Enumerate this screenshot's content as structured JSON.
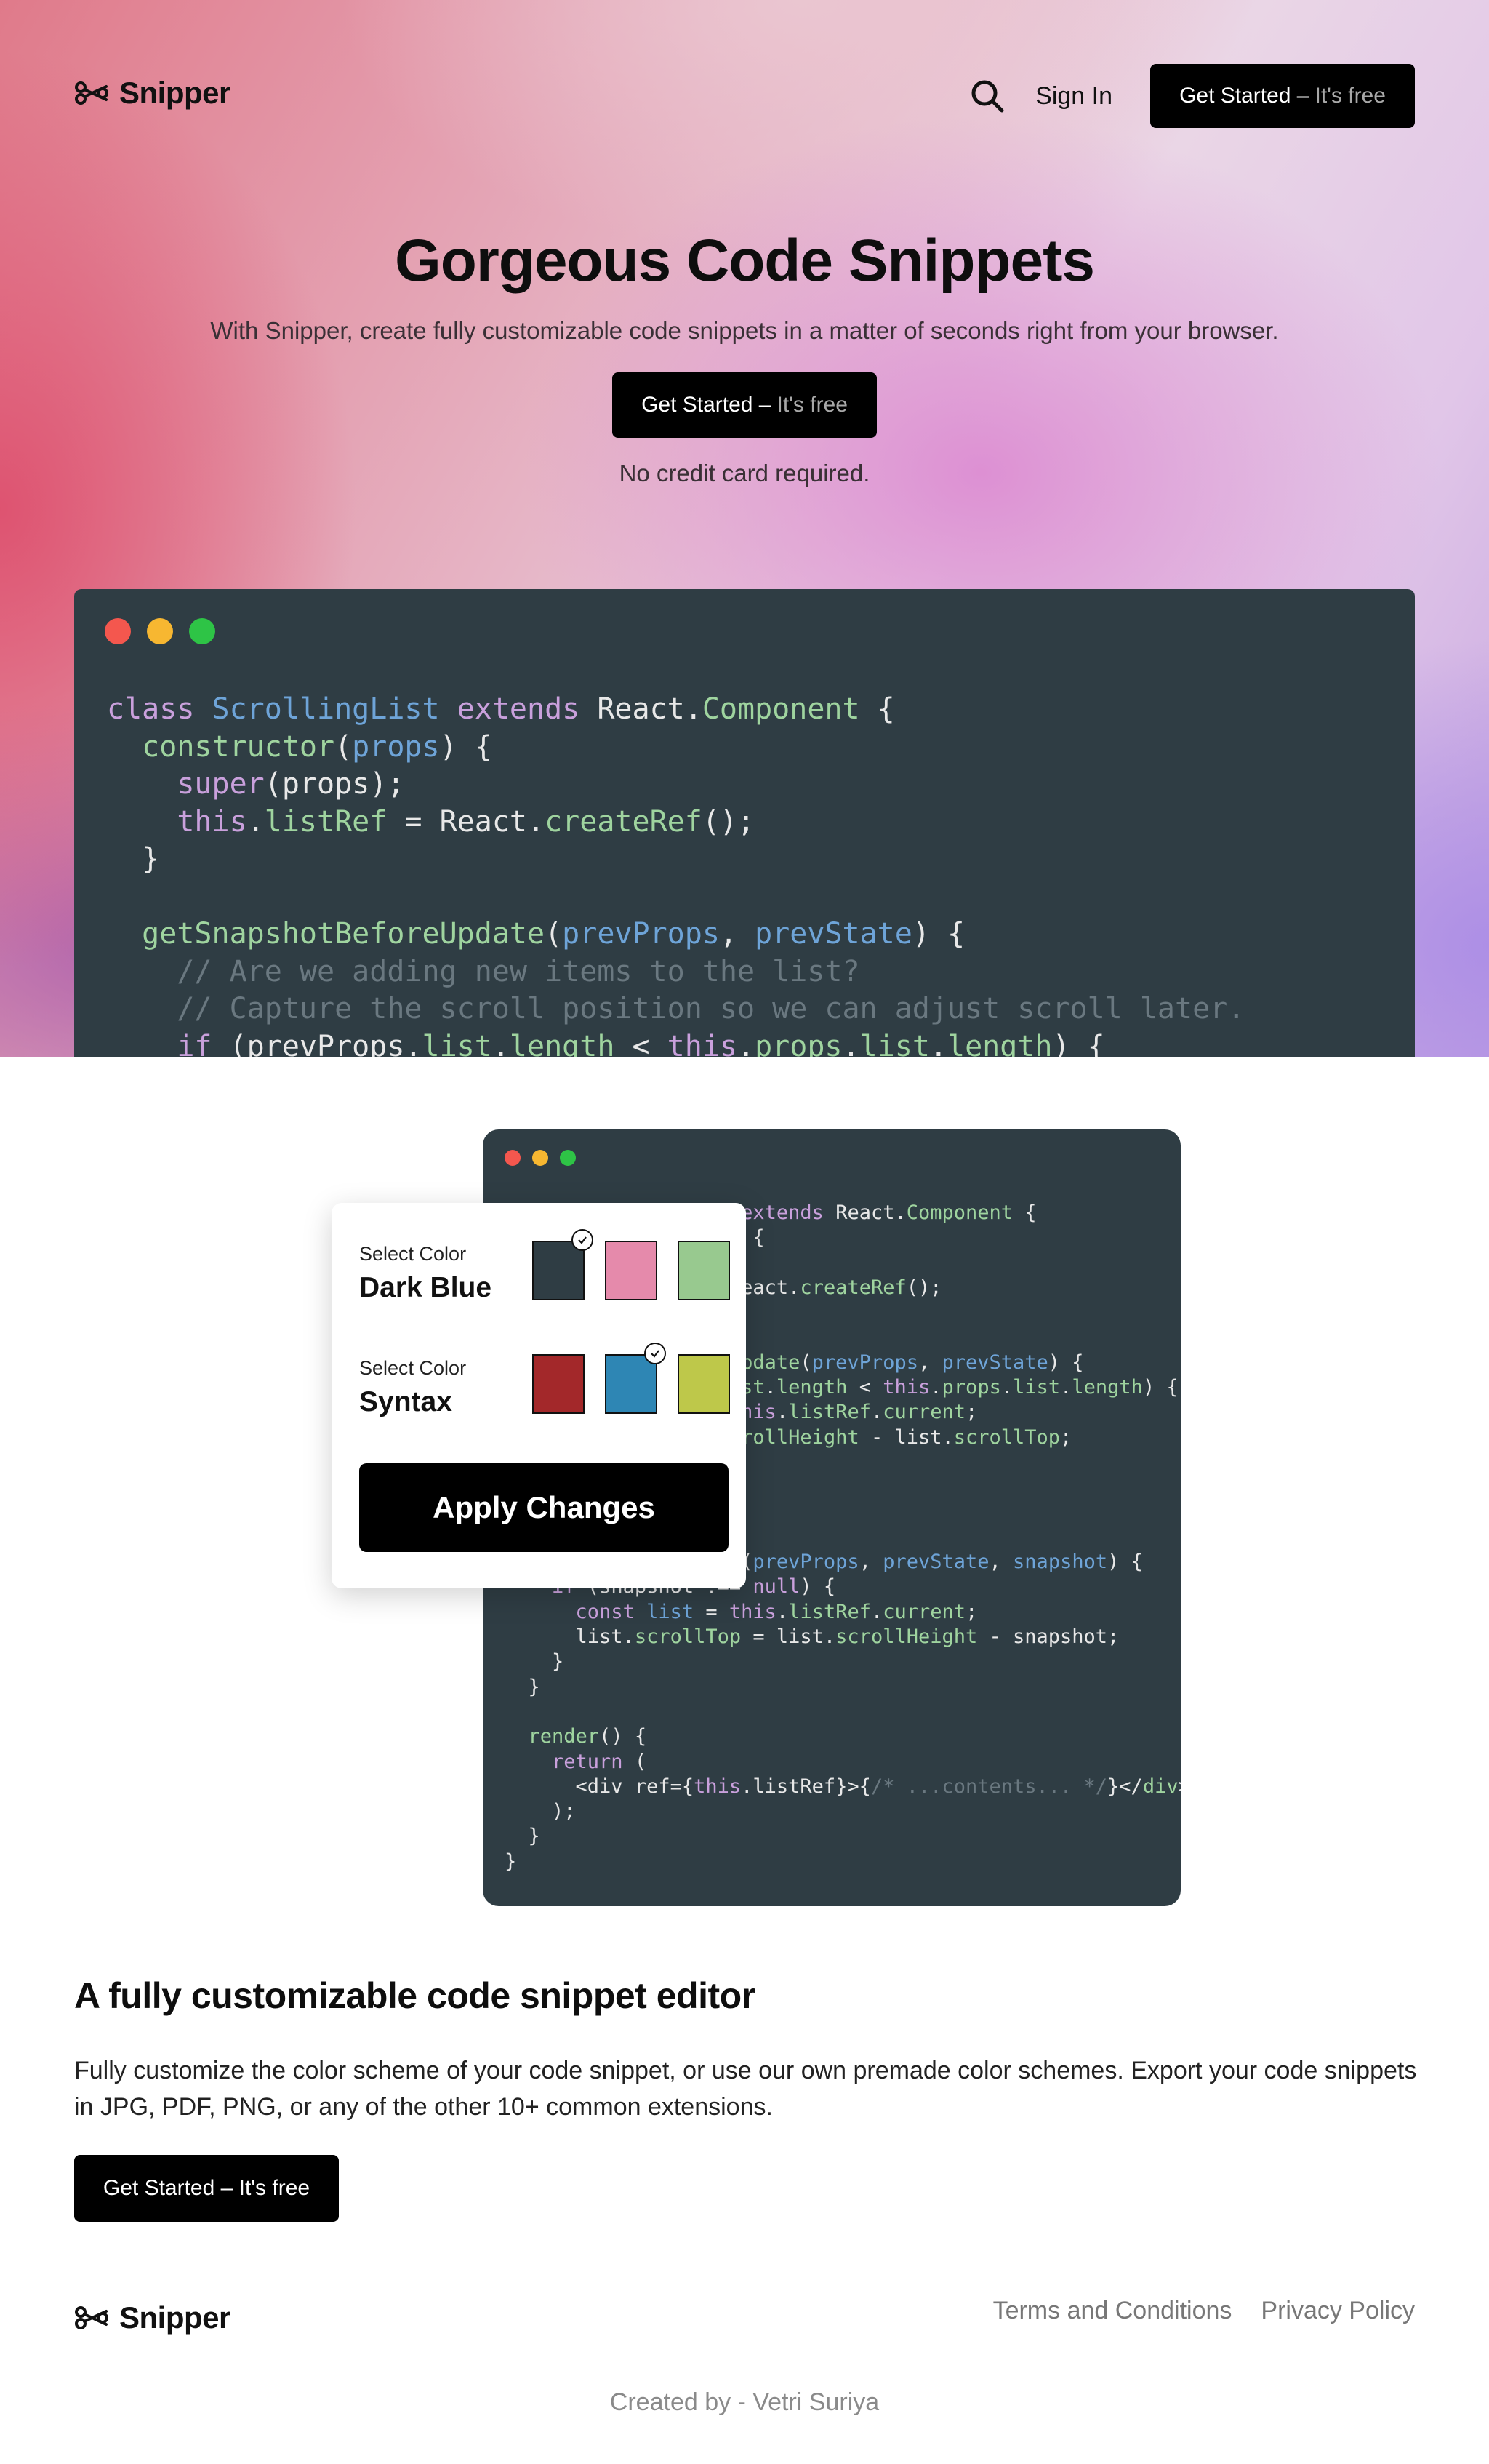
{
  "nav": {
    "brand": "Snipper",
    "sign_in": "Sign In",
    "cta_main": "Get Started –",
    "cta_sub": "It's free"
  },
  "hero": {
    "title": "Gorgeous Code Snippets",
    "subtitle": "With Snipper, create fully customizable code snippets in a matter of seconds right from your browser.",
    "cta_main": "Get Started –",
    "cta_sub": "It's free",
    "note": "No credit card required."
  },
  "editor_panel": {
    "theme_label": "Select Color",
    "theme_value": "Dark Blue",
    "syntax_label": "Select Color",
    "syntax_value": "Syntax",
    "apply": "Apply Changes",
    "theme_swatches": [
      "#2f3d44",
      "#e58aab",
      "#98c98f"
    ],
    "syntax_swatches": [
      "#a3282a",
      "#2e86b4",
      "#bec84a"
    ]
  },
  "feature": {
    "title": "A fully customizable code snippet editor",
    "text": "Fully customize the color scheme of your code snippet, or use our own premade color schemes. Export your code snippets in JPG, PDF, PNG, or any of the other 10+ common extensions.",
    "cta": "Get Started – It's free"
  },
  "footer": {
    "brand": "Snipper",
    "terms": "Terms and Conditions",
    "privacy": "Privacy Policy",
    "credit": "Created by - Vetri Suriya"
  },
  "colors": {
    "code_bg": "#2f3d44",
    "keyword": "#c9a0dc",
    "class": "#6ea4d8",
    "function": "#9fd49f",
    "comment": "#6a7880"
  },
  "icons": [
    "snipper-logo-icon",
    "search-icon",
    "check-icon"
  ]
}
